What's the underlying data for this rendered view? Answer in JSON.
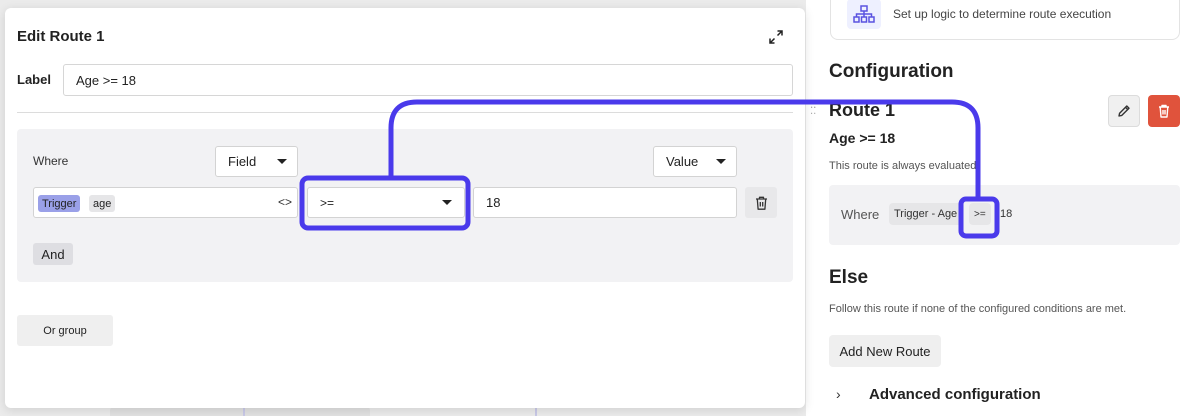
{
  "modal": {
    "title": "Edit Route 1",
    "label_caption": "Label",
    "label_value": "Age >= 18",
    "where_label": "Where",
    "field_select": "Field",
    "value_select": "Value",
    "field_chips": {
      "trigger": "Trigger",
      "field": "age"
    },
    "code_icon": "<>",
    "operator": ">=",
    "value": "18",
    "and_button": "And",
    "or_group_button": "Or group"
  },
  "right_panel": {
    "info_text": "Set up logic to determine route execution",
    "configuration_title": "Configuration",
    "route_title": "Route 1",
    "route_label": "Age >= 18",
    "route_note": "This route is always evaluated.",
    "where_label": "Where",
    "summary_chips": [
      "Trigger - Age",
      ">=",
      "18"
    ],
    "else_title": "Else",
    "else_note": "Follow this route if none of the configured conditions are met.",
    "add_route_button": "Add New Route",
    "advanced_chevron": "›",
    "advanced_label": "Advanced configuration"
  },
  "colors": {
    "annotation": "#4a3aeb",
    "trigger_chip": "#9aa0e8",
    "delete": "#e0533c"
  },
  "icons": [
    "org-chart-icon",
    "expand-icon",
    "trash-icon",
    "pencil-icon",
    "code-icon",
    "caret-down-icon",
    "chevron-right-icon"
  ]
}
